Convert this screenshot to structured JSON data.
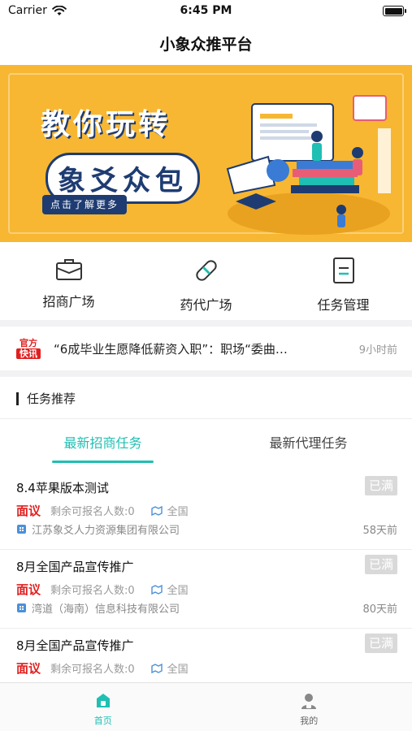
{
  "status_bar": {
    "carrier": "Carrier",
    "time": "6:45 PM"
  },
  "header": {
    "title": "小象众推平台"
  },
  "banner": {
    "line1": "教你玩转",
    "line2": "象爻众包",
    "button": "点击了解更多"
  },
  "quick_entries": [
    {
      "label": "招商广场",
      "icon": "briefcase-icon"
    },
    {
      "label": "药代广场",
      "icon": "pill-icon"
    },
    {
      "label": "任务管理",
      "icon": "task-list-icon"
    }
  ],
  "news": {
    "logo_top": "官方",
    "logo_bottom": "快讯",
    "headline": "“6成毕业生愿降低薪资入职”：职场“委曲…",
    "time": "9小时前"
  },
  "section": {
    "title": "任务推荐"
  },
  "tabs": [
    {
      "label": "最新招商任务",
      "active": true
    },
    {
      "label": "最新代理任务",
      "active": false
    }
  ],
  "tasks": [
    {
      "title": "8.4苹果版本测试",
      "status": "已满",
      "price": "面议",
      "remaining": "剩余可报名人数:0",
      "region": "全国",
      "company": "江苏象爻人力资源集团有限公司",
      "posted": "58天前"
    },
    {
      "title": "8月全国产品宣传推广",
      "status": "已满",
      "price": "面议",
      "remaining": "剩余可报名人数:0",
      "region": "全国",
      "company": "湾道（海南）信息科技有限公司",
      "posted": "80天前"
    },
    {
      "title": "8月全国产品宣传推广",
      "status": "已满",
      "price": "面议",
      "remaining": "剩余可报名人数:0",
      "region": "全国",
      "company": "",
      "posted": ""
    }
  ],
  "tab_bar": [
    {
      "label": "首页",
      "icon": "home-icon",
      "active": true
    },
    {
      "label": "我的",
      "icon": "profile-icon",
      "active": false
    }
  ],
  "colors": {
    "accent": "#1fbfb3",
    "price": "#e02020",
    "banner_bg": "#f7b733",
    "banner_navy": "#1e3c72",
    "badge": "#d9d9d9"
  }
}
